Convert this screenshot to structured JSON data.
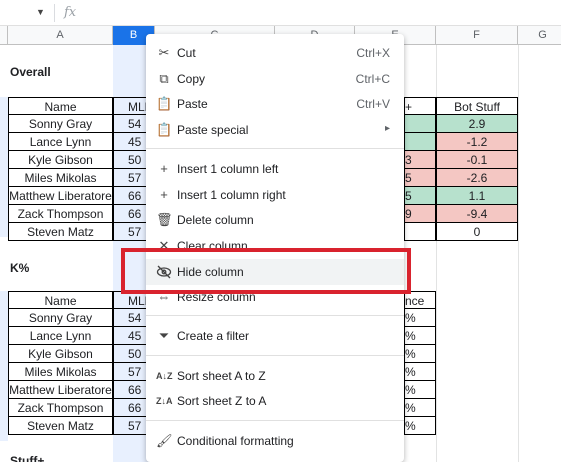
{
  "formula_bar": {
    "fx_label": "fx",
    "dropdown_icon": "chevron-down-icon"
  },
  "columns": [
    "A",
    "B",
    "C",
    "D",
    "E",
    "F",
    "G"
  ],
  "sheet": {
    "overall_title": "Overall",
    "header": {
      "name": "Name",
      "b": "MLE",
      "e": "+",
      "f": "Bot Stuff"
    },
    "overall_rows": [
      {
        "name": "Sonny Gray",
        "b": "54",
        "f": "2.9"
      },
      {
        "name": "Lance Lynn",
        "b": "45",
        "f": "-1.2"
      },
      {
        "name": "Kyle Gibson",
        "b": "50",
        "e": "3",
        "f": "-0.1"
      },
      {
        "name": "Miles Mikolas",
        "b": "57",
        "e": "5",
        "f": "-2.6"
      },
      {
        "name": "Matthew Liberatore",
        "b": "66",
        "e": "5",
        "f": "1.1"
      },
      {
        "name": "Zack Thompson",
        "b": "66",
        "e": "9",
        "f": "-9.4"
      },
      {
        "name": "Steven Matz",
        "b": "57",
        "f": "0"
      }
    ],
    "k_title": "K%",
    "k_header": {
      "name": "Name",
      "b": "MLE",
      "e": "nce"
    },
    "k_rows": [
      {
        "name": "Sonny Gray",
        "b": "54",
        "e": "%"
      },
      {
        "name": "Lance Lynn",
        "b": "45",
        "e": "%"
      },
      {
        "name": "Kyle Gibson",
        "b": "50",
        "e": "%"
      },
      {
        "name": "Miles Mikolas",
        "b": "57",
        "e": "%"
      },
      {
        "name": "Matthew Liberatore",
        "b": "66",
        "e": "%"
      },
      {
        "name": "Zack Thompson",
        "b": "66",
        "e": "%"
      },
      {
        "name": "Steven Matz",
        "b": "57",
        "e": "%"
      }
    ],
    "stuff_title": "Stuff+"
  },
  "menu": {
    "cut": {
      "label": "Cut",
      "shortcut": "Ctrl+X"
    },
    "copy": {
      "label": "Copy",
      "shortcut": "Ctrl+C"
    },
    "paste": {
      "label": "Paste",
      "shortcut": "Ctrl+V"
    },
    "paste_special": {
      "label": "Paste special",
      "arrow": "▸"
    },
    "insert_left": {
      "label": "Insert 1 column left"
    },
    "insert_right": {
      "label": "Insert 1 column right"
    },
    "delete_column": {
      "label": "Delete column"
    },
    "clear_column": {
      "label": "Clear column"
    },
    "hide_column": {
      "label": "Hide column"
    },
    "resize_column": {
      "label": "Resize column"
    },
    "create_filter": {
      "label": "Create a filter"
    },
    "sort_az": {
      "label": "Sort sheet A to Z"
    },
    "sort_za": {
      "label": "Sort sheet Z to A"
    },
    "conditional_formatting": {
      "label": "Conditional formatting"
    }
  },
  "colors": {
    "selected_header": "#1a73e8",
    "highlight_box": "#d9232e",
    "positive": "#b7e1cd",
    "negative": "#f4c7c3"
  }
}
